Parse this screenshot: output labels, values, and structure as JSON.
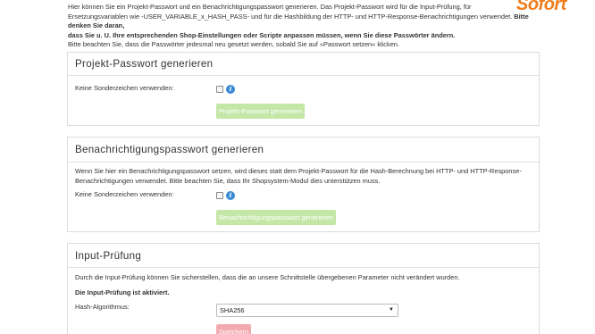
{
  "intro": {
    "line1": "Hier können Sie ein Projekt-Passwort und ein Benachrichtigungspasswort generieren. Das Projekt-Passwort wird für die Input-Prüfung, für",
    "line2": "Ersetzungsvariablen wie -USER_VARIABLE_x_HASH_PASS- und für die Hashbildung der HTTP- und HTTP-Response-Benachrichtigungen verwendet.",
    "line2_bold": "Bitte denken Sie daran,",
    "line3_bold": "dass Sie u. U. Ihre entsprechenden Shop-Einstellungen oder Scripte anpassen müssen, wenn Sie diese Passwörter ändern.",
    "line4": "Bitte beachten Sie, dass die Passwörter jedesmal neu gesetzt werden, sobald Sie auf »Passwort setzen« klicken."
  },
  "logo": {
    "text": "Sofort"
  },
  "project_panel": {
    "title": "Projekt-Passwort generieren",
    "no_special_chars_label": "Keine Sonderzeichen verwenden:",
    "info_icon": "i",
    "button_label": "Projekt-Passwort generieren"
  },
  "notification_panel": {
    "title": "Benachrichtigungspasswort generieren",
    "desc_line1": "Wenn Sie hier ein Benachrichtigungspasswort setzen, wird dieses statt dem Projekt-Passwort für die Hash-Berechnung bei HTTP- und HTTP-Response-",
    "desc_line2": "Benachrichtigungen verwendet. Bitte beachten Sie, dass Ihr Shopsystem-Modul dies unterstützen muss.",
    "no_special_chars_label": "Keine Sonderzeichen verwenden:",
    "info_icon": "i",
    "button_label": "Benachrichtigungspasswort generieren"
  },
  "input_check_panel": {
    "title": "Input-Prüfung",
    "desc": "Durch die Input-Prüfung können Sie sicherstellen, dass die an unsere Schnittstelle übergebenen Parameter nicht verändert wurden.",
    "status": "Die Input-Prüfung ist aktiviert.",
    "hash_label": "Hash-Algorithmus:",
    "hash_value": "SHA256",
    "save_label": "Speichern"
  },
  "colors": {
    "accent_orange": "#f07c1a",
    "button_green_disabled": "#c4e7a8",
    "button_red_disabled": "#f2aab0",
    "info_blue": "#3a8ad6"
  }
}
